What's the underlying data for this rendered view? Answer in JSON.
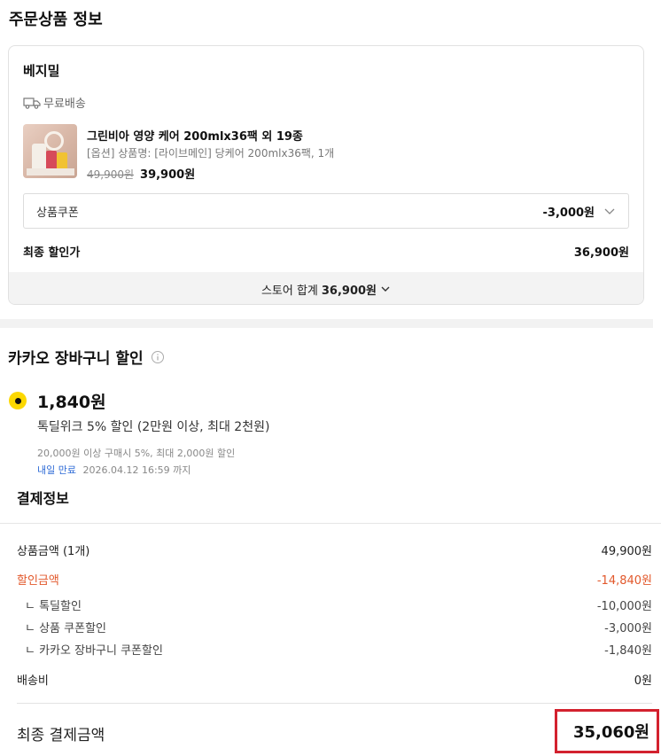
{
  "section_title": "주문상품 정보",
  "store": {
    "name": "베지밀",
    "shipping_label": "무료배송",
    "product": {
      "name": "그린비아 영양 케어 200mlx36팩 외 19종",
      "option": "[옵션] 상품명: [라이브메인] 당케어 200mlx36팩, 1개",
      "original_price": "49,900원",
      "sale_price": "39,900원"
    },
    "coupon": {
      "label": "상품쿠폰",
      "value": "-3,000원"
    },
    "final": {
      "label": "최종 할인가",
      "value": "36,900원"
    },
    "total": {
      "label": "스토어 합계",
      "value": "36,900원"
    }
  },
  "kakao": {
    "title": "카카오 장바구니 할인",
    "amount": "1,840원",
    "description": "톡딜위크 5% 할인 (2만원 이상, 최대 2천원)",
    "condition": "20,000원 이상 구매시 5%, 최대 2,000원 할인",
    "expire_tag": "내일 만료",
    "expire_date": "2026.04.12 16:59 까지"
  },
  "payment": {
    "title": "결제정보",
    "rows": [
      {
        "label": "상품금액 (1개)",
        "value": "49,900원"
      },
      {
        "label": "할인금액",
        "value": "-14,840원"
      },
      {
        "label": "ㄴ 톡딜할인",
        "value": "-10,000원"
      },
      {
        "label": "ㄴ 상품 쿠폰할인",
        "value": "-3,000원"
      },
      {
        "label": "ㄴ 카카오 장바구니 쿠폰할인",
        "value": "-1,840원"
      },
      {
        "label": "배송비",
        "value": "0원"
      }
    ],
    "final_label": "최종 결제금액",
    "final_value": "35,060원"
  },
  "colors": {
    "accent_yellow": "#fcd800",
    "discount_red": "#e2582b",
    "highlight_box": "#d3212e",
    "expire_blue": "#2d6ad6"
  }
}
